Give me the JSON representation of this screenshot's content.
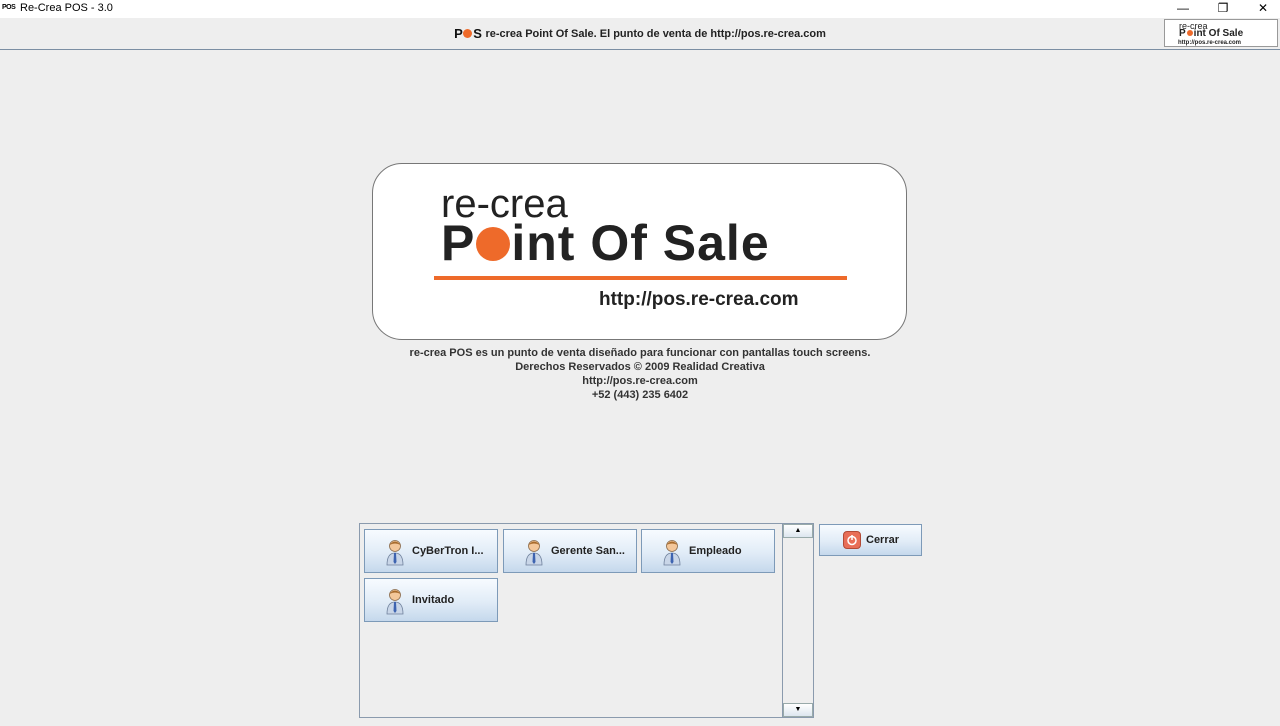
{
  "window": {
    "title": "Re-Crea POS - 3.0",
    "icon_text": "POS",
    "minimize_glyph": "—",
    "restore_glyph": "❐",
    "close_glyph": "✕"
  },
  "header": {
    "logo_text_before": "P",
    "logo_text_after": "S",
    "text": "re-crea Point Of Sale. El punto de venta de http://pos.re-crea.com",
    "corner_logo": {
      "line1": "re-crea",
      "line2_before": "P",
      "line2_after": "int Of Sale",
      "line3": "http://pos.re-crea.com"
    }
  },
  "logo": {
    "recrea": "re-crea",
    "title_before": "P",
    "title_after": "int Of Sale",
    "url": "http://pos.re-crea.com"
  },
  "info": {
    "line1": "re-crea POS es un punto de venta diseñado para funcionar con pantallas touch screens.",
    "line2": "Derechos Reservados © 2009 Realidad Creativa",
    "line3": "http://pos.re-crea.com",
    "line4": "+52 (443) 235 6402"
  },
  "users": [
    {
      "label": "CyBerTron I...",
      "icon": "user-icon"
    },
    {
      "label": "Gerente San...",
      "icon": "user-icon"
    },
    {
      "label": "Empleado",
      "icon": "user-icon"
    },
    {
      "label": "Invitado",
      "icon": "user-icon"
    }
  ],
  "close_button": {
    "label": "Cerrar",
    "icon": "power-icon"
  },
  "scrollbar": {
    "up": "▲",
    "down": "▼"
  },
  "colors": {
    "accent": "#ee6a2a",
    "button_border": "#7d9ab8"
  }
}
